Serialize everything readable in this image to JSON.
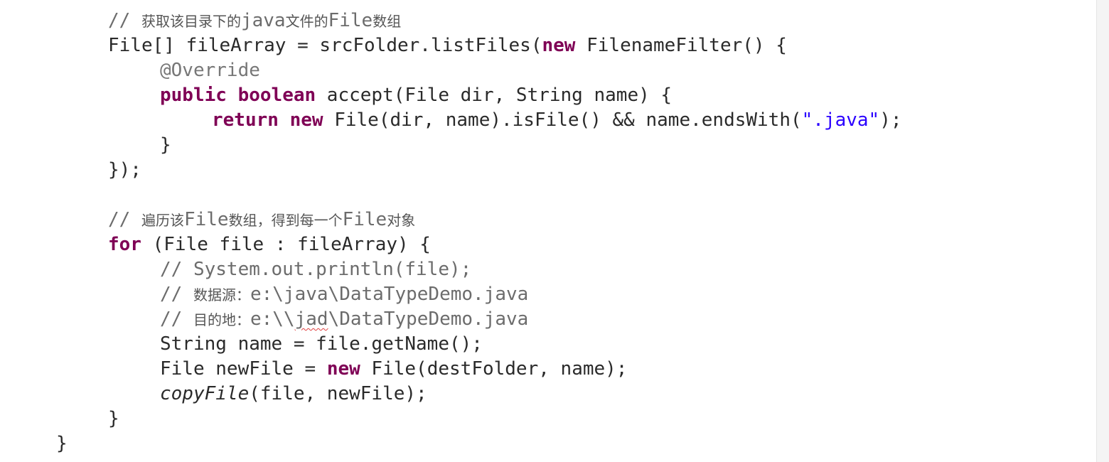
{
  "code": {
    "l1": {
      "comment_prefix": "// ",
      "comment_cn1": "获取该目录下的",
      "comment_mono1": "java",
      "comment_cn2": "文件的",
      "comment_mono2": "File",
      "comment_cn3": "数组"
    },
    "l2": {
      "t1": "File[] fileArray = srcFolder.listFiles(",
      "kw_new": "new",
      "t2": " FilenameFilter() {"
    },
    "l3": {
      "annotation": "@Override"
    },
    "l4": {
      "kw_public": "public",
      "kw_boolean": "boolean",
      "t1": " accept(File dir, String name) {"
    },
    "l5": {
      "kw_return": "return",
      "kw_new": "new",
      "t1": " File(dir, name).isFile() && name.endsWith(",
      "str": "\".java\"",
      "t2": ");"
    },
    "l6": {
      "t1": "}"
    },
    "l7": {
      "t1": "});"
    },
    "l8": {
      "comment_prefix": "// ",
      "comment_cn1": "遍历该",
      "comment_mono1": "File",
      "comment_cn2": "数组，得到每一个",
      "comment_mono2": "File",
      "comment_cn3": "对象"
    },
    "l9": {
      "kw_for": "for",
      "t1": " (File file : fileArray) {"
    },
    "l10": {
      "comment": "// System.out.println(file);"
    },
    "l11": {
      "comment_prefix": "// ",
      "comment_cn": "数据源：",
      "comment_mono": "e:\\java\\DataTypeDemo.java"
    },
    "l12": {
      "comment_prefix": "// ",
      "comment_cn": "目的地：",
      "comment_mono1": "e:\\\\",
      "comment_squig": "jad",
      "comment_mono2": "\\DataTypeDemo.java"
    },
    "l13": {
      "t1": "String name = file.getName();"
    },
    "l14": {
      "t1": "File newFile = ",
      "kw_new": "new",
      "t2": " File(destFolder, name);"
    },
    "l15": {
      "italic": "copyFile",
      "t1": "(file, newFile);"
    },
    "l16": {
      "t1": "}"
    },
    "l17": {
      "t1": "}"
    }
  },
  "colors": {
    "keyword": "#7f0055",
    "comment": "#6c6c6c",
    "string": "#2a00ff",
    "text": "#2a2a2a"
  }
}
